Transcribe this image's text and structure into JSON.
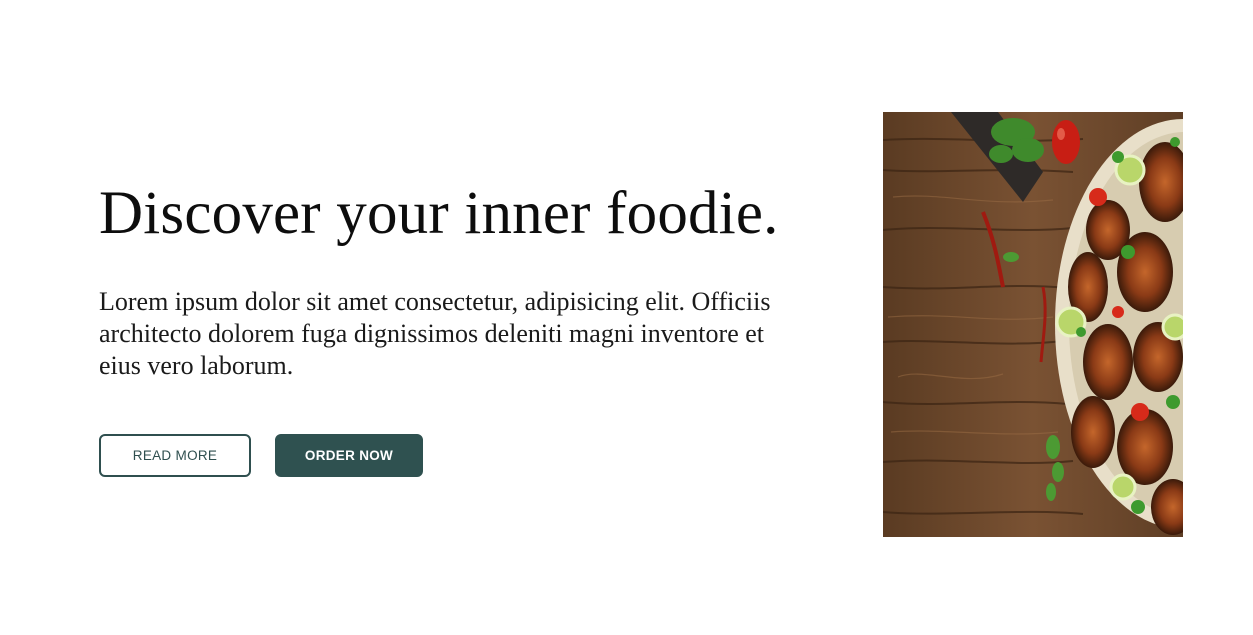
{
  "hero": {
    "title": "Discover your inner foodie.",
    "description": "Lorem ipsum dolor sit amet consectetur, adipisicing elit. Officiis architecto dolorem fuga dignissimos deleniti magni inventore et eius vero laborum.",
    "read_more_label": "READ MORE",
    "order_now_label": "ORDER NOW"
  },
  "colors": {
    "accent": "#2f5150",
    "text": "#0d0d0d",
    "background": "#ffffff"
  },
  "image": {
    "icon": "food-photo-icon"
  }
}
